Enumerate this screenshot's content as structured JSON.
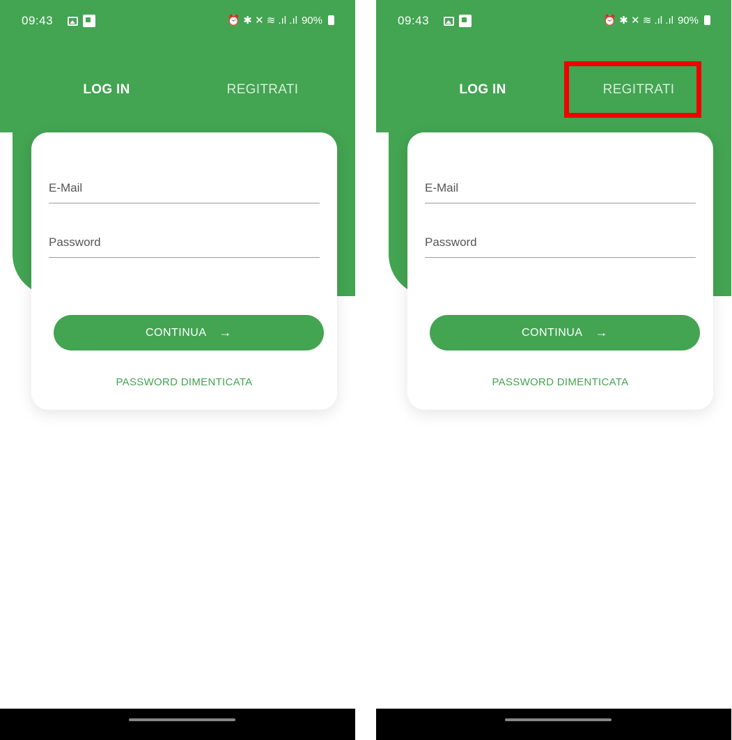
{
  "status": {
    "time": "09:43",
    "icons": "⏰ ✱ ✕ ≋ .ıl .ıl",
    "battery": "90%"
  },
  "tabs": {
    "login": "LOG IN",
    "register": "REGITRATI"
  },
  "form": {
    "email_placeholder": "E-Mail",
    "password_placeholder": "Password",
    "continue_label": "CONTINUA",
    "continue_arrow": "→",
    "forgot_label": "PASSWORD DIMENTICATA"
  },
  "colors": {
    "accent": "#43a452",
    "highlight": "#f00000"
  },
  "annotation": {
    "highlighted_element": "REGITRATI"
  }
}
